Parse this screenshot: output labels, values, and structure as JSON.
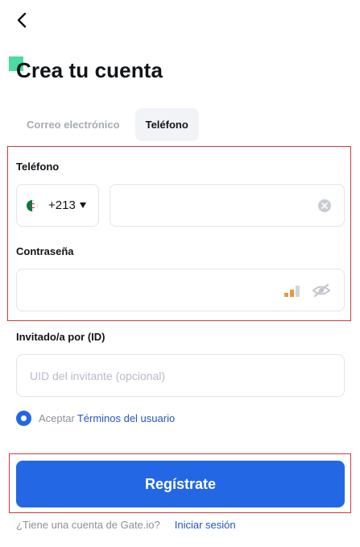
{
  "header": {
    "back_icon": "chevron-left-icon",
    "title": "Crea tu cuenta",
    "accent_color": "#2ad58e"
  },
  "tabs": [
    {
      "label": "Correo electrónico",
      "active": false
    },
    {
      "label": "Teléfono",
      "active": true
    }
  ],
  "phone": {
    "label": "Teléfono",
    "country_flag": "algeria-flag-icon",
    "country_code": "+213",
    "value": "",
    "clear_icon": "clear-circle-icon"
  },
  "password": {
    "label": "Contraseña",
    "value": "",
    "strength_icon": "strength-bars-icon",
    "strength_color": "#e59a3c",
    "visibility_icon": "eye-off-icon"
  },
  "invite": {
    "label": "Invitado/a por (ID)",
    "value": "",
    "placeholder": "UID del invitante (opcional)"
  },
  "terms": {
    "checked": true,
    "prefix": "Aceptar",
    "link": "Términos del usuario"
  },
  "submit": {
    "label": "Regístrate",
    "color": "#2467e4"
  },
  "login": {
    "prefix": "¿Tiene una cuenta de Gate.io?",
    "link": "Iniciar sesión"
  },
  "highlight_color": "#d9363e"
}
